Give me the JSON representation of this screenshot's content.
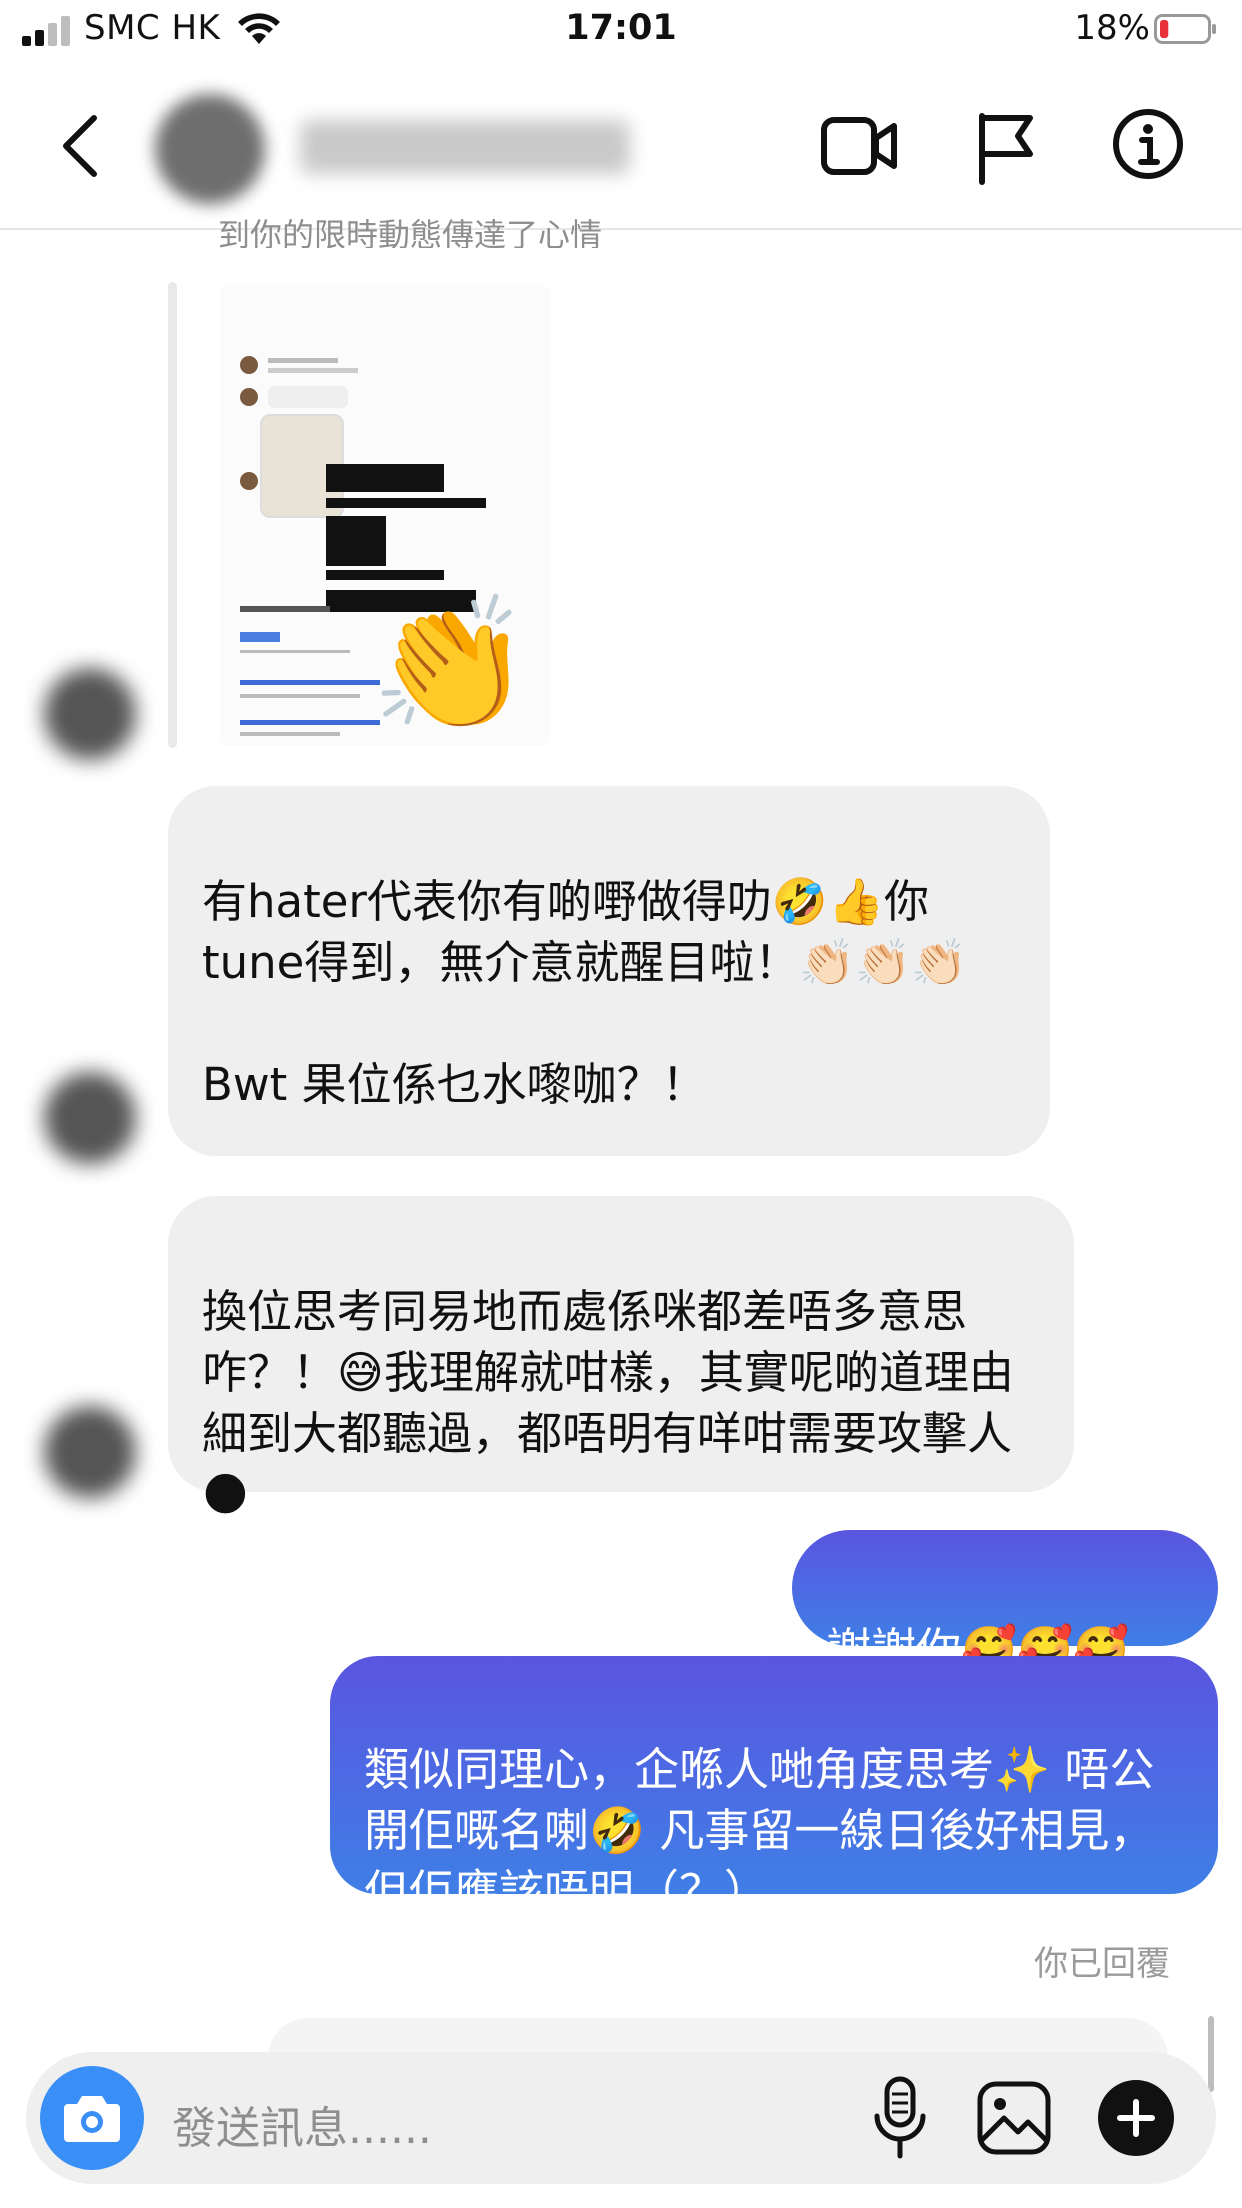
{
  "status_bar": {
    "carrier": "SMC HK",
    "time": "17:01",
    "battery_percent": "18%",
    "battery_level": 0.18
  },
  "header": {
    "back_icon": "chevron-left-icon",
    "video_icon": "video-camera-icon",
    "report_icon": "flag-icon",
    "info_icon": "info-icon"
  },
  "thread": {
    "faded_note": "到你的限時動態傳達了心情",
    "shared_story": {
      "reaction_emoji": "👏"
    },
    "messages": [
      {
        "side": "received",
        "text": "有hater代表你有啲嘢做得叻🤣👍你tune得到，無介意就醒目啦！👏🏻👏🏻👏🏻\n\nBwt 果位係乜水嚟咖？！"
      },
      {
        "side": "received",
        "text": "換位思考同易地而處係咪都差唔多意思咋？！😅我理解就咁樣，其實呢啲道理由細到大都聽過，都唔明有咩咁需要攻擊人🌑"
      },
      {
        "side": "sent",
        "text": "謝謝你🥰🥰🥰"
      },
      {
        "side": "sent",
        "text": "類似同理心，企喺人哋角度思考✨ 唔公開佢嘅名喇🤣 凡事留一線日後好相見，但佢應該唔明（？）"
      }
    ],
    "replied_label": "你已回覆"
  },
  "composer": {
    "placeholder": "發送訊息......",
    "camera_icon": "camera-icon",
    "mic_icon": "microphone-icon",
    "gallery_icon": "image-icon",
    "plus_icon": "plus-icon"
  },
  "colors": {
    "received_bubble": "#efefef",
    "sent_top": "#5a55e0",
    "sent_bottom": "#3f7fe6",
    "camera_button": "#3a8ff7"
  }
}
